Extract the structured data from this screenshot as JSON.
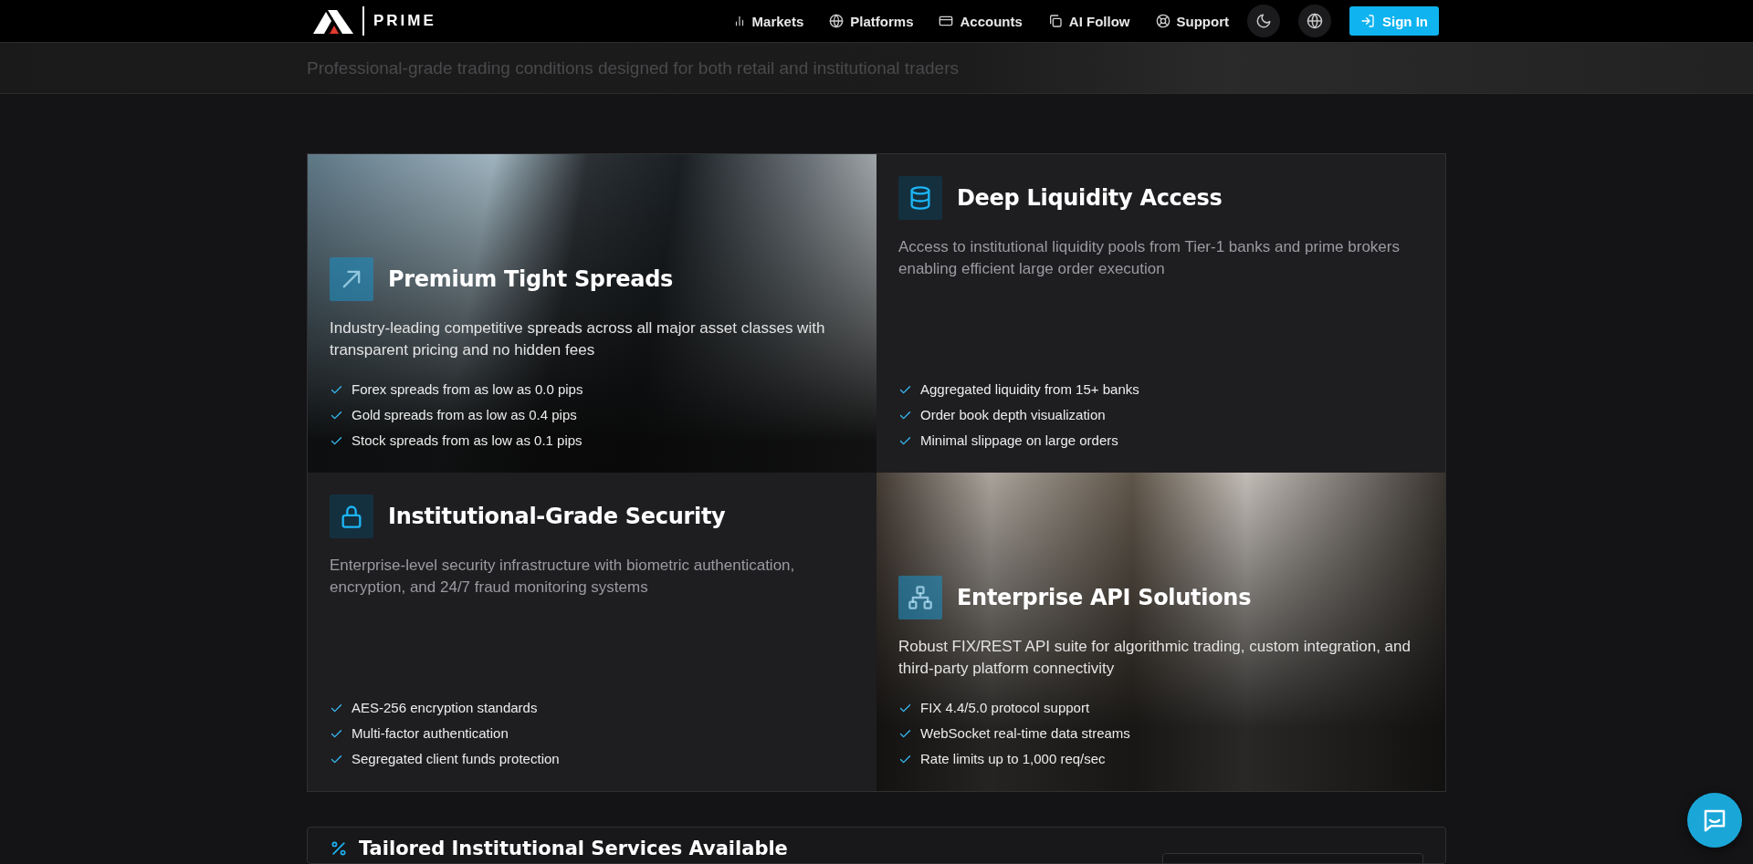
{
  "header": {
    "logo": "PRIME",
    "nav": [
      {
        "label": "Markets"
      },
      {
        "label": "Platforms"
      },
      {
        "label": "Accounts"
      },
      {
        "label": "AI Follow"
      },
      {
        "label": "Support"
      }
    ],
    "sign_in": "Sign In"
  },
  "hero": {
    "subtitle": "Professional-grade trading conditions designed for both retail and institutional traders"
  },
  "features": [
    {
      "kind": "photo",
      "title": "Premium Tight Spreads",
      "description": "Industry-leading competitive spreads across all major asset classes with transparent pricing and no hidden fees",
      "points": [
        "Forex spreads from as low as 0.0 pips",
        "Gold spreads from as low as 0.4 pips",
        "Stock spreads from as low as 0.1 pips"
      ]
    },
    {
      "kind": "plain",
      "title": "Deep Liquidity Access",
      "description": "Access to institutional liquidity pools from Tier-1 banks and prime brokers enabling efficient large order execution",
      "points": [
        "Aggregated liquidity from 15+ banks",
        "Order book depth visualization",
        "Minimal slippage on large orders"
      ]
    },
    {
      "kind": "plain",
      "title": "Institutional-Grade Security",
      "description": "Enterprise-level security infrastructure with biometric authentication, encryption, and 24/7 fraud monitoring systems",
      "points": [
        "AES-256 encryption standards",
        "Multi-factor authentication",
        "Segregated client funds protection"
      ]
    },
    {
      "kind": "photo",
      "title": "Enterprise API Solutions",
      "description": "Robust FIX/REST API suite for algorithmic trading, custom integration, and third-party platform connectivity",
      "points": [
        "FIX 4.4/5.0 protocol support",
        "WebSocket real-time data streams",
        "Rate limits up to 1,000 req/sec"
      ]
    }
  ],
  "services": {
    "title": "Tailored Institutional Services Available"
  }
}
